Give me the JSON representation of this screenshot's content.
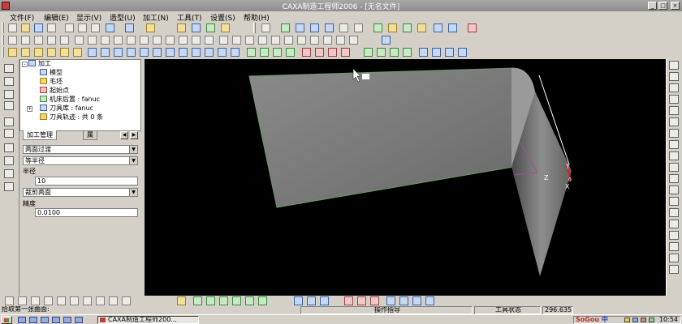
{
  "window": {
    "title": "CAXA制造工程师2006 - [无名文件]",
    "min_label": "_",
    "max_label": "□",
    "close_label": "×"
  },
  "menu": [
    {
      "label": "文件(F)"
    },
    {
      "label": "编辑(E)"
    },
    {
      "label": "显示(V)"
    },
    {
      "label": "造型(U)"
    },
    {
      "label": "加工(N)"
    },
    {
      "label": "工具(T)"
    },
    {
      "label": "设置(S)"
    },
    {
      "label": "帮助(H)"
    }
  ],
  "tree": {
    "expander": "-",
    "collapsed_expander": "+",
    "items": [
      {
        "label": "加工"
      },
      {
        "label": "模型"
      },
      {
        "label": "毛坯"
      },
      {
        "label": "起始点"
      },
      {
        "label": "机床后置 : fanuc"
      },
      {
        "label": "刀具库 : fanuc"
      },
      {
        "label": "刀具轨迹 : 共 0 条"
      }
    ]
  },
  "tabs": [
    {
      "label": "加工管理"
    },
    {
      "label": "属"
    }
  ],
  "tab_nav": {
    "prev": "◀",
    "next": "▶"
  },
  "props": {
    "surface_mode": "两面过渡",
    "radius_mode": "等半径",
    "radius_label": "半径",
    "radius_value": "10",
    "trim_mode": "裁剪两面",
    "precision_label": "精度",
    "precision_value": "0.0100",
    "dropdown_glyph": "▼"
  },
  "viewport": {
    "axis_y": "Y",
    "axis_z": "Z",
    "axis_x": "X",
    "axis_o": "0"
  },
  "status": {
    "prompt": "拾取第一张曲面:",
    "op_hint": "操作指导",
    "tool_state": "工具状态",
    "coord": "296.635"
  },
  "taskbar": {
    "task_label": "CAXA制造工程师200...",
    "ime_brand": "SoGou",
    "ime_mode": "中",
    "clock": "10:54"
  }
}
